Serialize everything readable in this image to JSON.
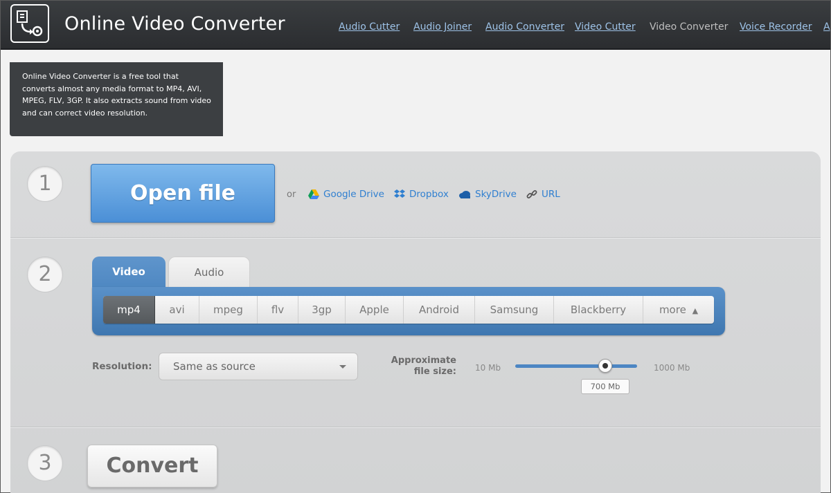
{
  "header": {
    "title": "Online Video Converter",
    "logo_icon": "convert-file-icon",
    "nav": [
      {
        "label": "Audio Cutter",
        "current": false
      },
      {
        "label": "Audio Joiner",
        "current": false
      },
      {
        "label": "Audio Converter",
        "current": false
      },
      {
        "label": "Video Cutter",
        "current": false
      },
      {
        "label": "Video Converter",
        "current": true
      },
      {
        "label": "Voice Recorder",
        "current": false
      },
      {
        "label": "A",
        "current": false
      }
    ]
  },
  "description": "Online Video Converter is a free tool that converts almost any media format to MP4, AVI, MPEG, FLV, 3GP. It also extracts sound from video and can correct video resolution.",
  "step1": {
    "number": "1",
    "open_label": "Open file",
    "or_label": "or",
    "sources": [
      {
        "label": "Google Drive",
        "icon": "google-drive-icon",
        "color": "#2f7fd0"
      },
      {
        "label": "Dropbox",
        "icon": "dropbox-icon",
        "color": "#2f7fd0"
      },
      {
        "label": "SkyDrive",
        "icon": "skydrive-icon",
        "color": "#2f7fd0"
      },
      {
        "label": "URL",
        "icon": "link-icon",
        "color": "#2f7fd0"
      }
    ]
  },
  "step2": {
    "number": "2",
    "tabs": [
      {
        "label": "Video",
        "active": true
      },
      {
        "label": "Audio",
        "active": false
      }
    ],
    "formats": [
      {
        "label": "mp4",
        "active": true
      },
      {
        "label": "avi",
        "active": false
      },
      {
        "label": "mpeg",
        "active": false
      },
      {
        "label": "flv",
        "active": false
      },
      {
        "label": "3gp",
        "active": false
      },
      {
        "label": "Apple",
        "active": false
      },
      {
        "label": "Android",
        "active": false
      },
      {
        "label": "Samsung",
        "active": false
      },
      {
        "label": "Blackberry",
        "active": false
      },
      {
        "label": "more",
        "active": false
      }
    ],
    "resolution_label": "Resolution:",
    "resolution_value": "Same as source",
    "size_label_line1": "Approximate",
    "size_label_line2": "file size:",
    "size_min": "10 Mb",
    "size_max": "1000 Mb",
    "size_value": "700 Mb"
  },
  "step3": {
    "number": "3",
    "convert_label": "Convert"
  },
  "colors": {
    "header_bg": "#2e3033",
    "accent_blue": "#4b8fd6",
    "link_blue": "#2f7fd0",
    "nav_link": "#9ec3e8"
  }
}
